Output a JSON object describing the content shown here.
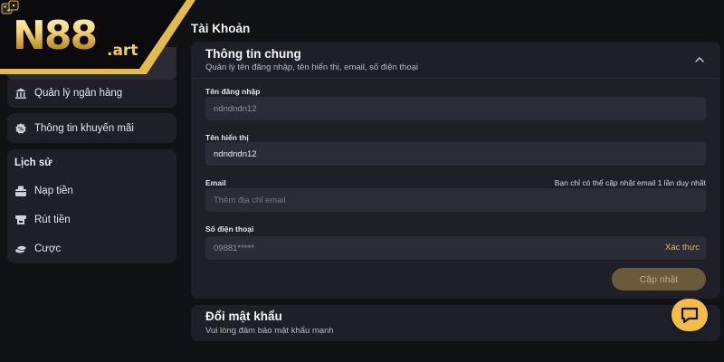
{
  "brand": {
    "logo_text": "N88",
    "logo_suffix": ".art"
  },
  "sidebar": {
    "items_top": [
      {
        "label": "Quản lý ngân hàng",
        "icon": "bank-icon"
      },
      {
        "label": "Thông tin khuyến mãi",
        "icon": "promo-icon"
      }
    ],
    "history_heading": "Lịch sử",
    "history_items": [
      {
        "label": "Nạp tiền",
        "icon": "deposit-icon"
      },
      {
        "label": "Rút tiền",
        "icon": "withdraw-icon"
      },
      {
        "label": "Cược",
        "icon": "bet-icon"
      }
    ]
  },
  "main": {
    "page_title": "Tài Khoản",
    "general": {
      "title": "Thông tin chung",
      "subtitle": "Quản lý tên đăng nhập, tên hiển thị, email, số điện thoại",
      "fields": {
        "username": {
          "label": "Tên đăng nhập",
          "value": "ndndndn12"
        },
        "display_name": {
          "label": "Tên hiển thị",
          "value": "ndndndn12"
        },
        "email": {
          "label": "Email",
          "placeholder": "Thêm địa chỉ email",
          "note": "Bạn chỉ có thể cập nhật email 1 lần duy nhất"
        },
        "phone": {
          "label": "Số điện thoại",
          "value": "09881*****",
          "action": "Xác thực"
        }
      },
      "update_button": "Cập nhật"
    },
    "password": {
      "title": "Đổi mật khẩu",
      "subtitle": "Vui lòng đảm bảo mật khẩu mạnh"
    }
  },
  "colors": {
    "background": "#111216",
    "card": "#1f2027",
    "input": "#2b2c37",
    "accent_gold": "#f2bd4b",
    "link": "#e2b866"
  }
}
